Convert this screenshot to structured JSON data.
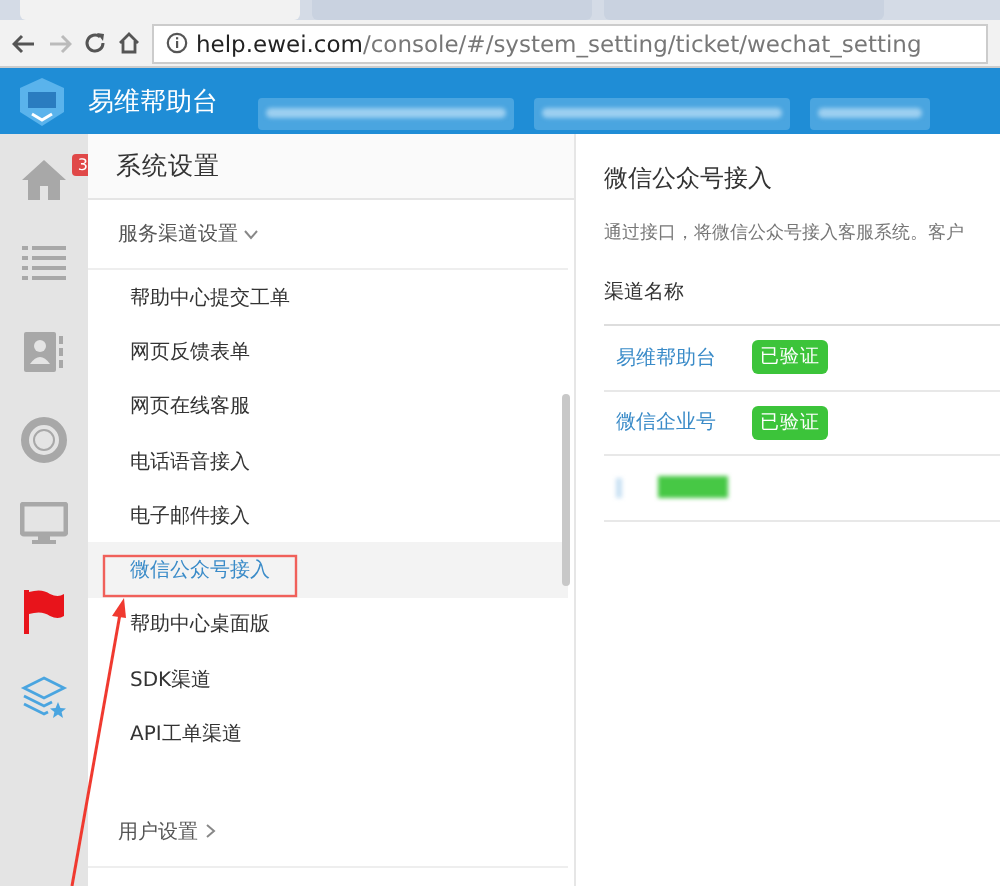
{
  "browser": {
    "tabs": [
      {
        "selected": true
      },
      {
        "selected": false
      },
      {
        "selected": false
      }
    ],
    "address": {
      "host": "help.ewei.com",
      "path": "/console/#/system_setting/ticket/wechat_setting"
    }
  },
  "app_header": {
    "brand": "易维帮助台"
  },
  "icon_bar": [
    {
      "kind": "home",
      "badge": "3"
    },
    {
      "kind": "list"
    },
    {
      "kind": "contact"
    },
    {
      "kind": "lifebuoy"
    },
    {
      "kind": "monitor"
    },
    {
      "kind": "flag"
    },
    {
      "kind": "layers"
    }
  ],
  "sidebar": {
    "title": "系统设置",
    "groups": [
      {
        "label": "服务渠道设置",
        "expanded": true,
        "items": [
          {
            "label": "帮助中心提交工单",
            "selected": false
          },
          {
            "label": "网页反馈表单",
            "selected": false
          },
          {
            "label": "网页在线客服",
            "selected": false
          },
          {
            "label": "电话语音接入",
            "selected": false
          },
          {
            "label": "电子邮件接入",
            "selected": false
          },
          {
            "label": "微信公众号接入",
            "selected": true
          },
          {
            "label": "帮助中心桌面版",
            "selected": false
          },
          {
            "label": "SDK渠道",
            "selected": false
          },
          {
            "label": "API工单渠道",
            "selected": false
          }
        ]
      },
      {
        "label": "用户设置",
        "expanded": false
      }
    ]
  },
  "main": {
    "title": "微信公众号接入",
    "description": "通过接口，将微信公众号接入客服系统。客户",
    "table": {
      "columns": [
        "渠道名称"
      ],
      "rows": [
        {
          "name": "易维帮助台",
          "status": "已验证"
        },
        {
          "name": "微信企业号",
          "status": "已验证"
        }
      ]
    }
  }
}
